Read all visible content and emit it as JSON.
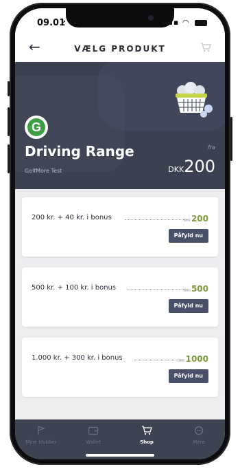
{
  "status": {
    "time": "09.01",
    "signal": "▪▪▪",
    "wifi": "◠"
  },
  "nav": {
    "title": "VÆLG PRODUKT"
  },
  "hero": {
    "club_initial": "G",
    "title": "Driving Range",
    "subtitle": "GolfMore Test",
    "from_label": "fra",
    "currency": "DKK",
    "price": "200"
  },
  "products": [
    {
      "label": "200 kr. + 40 kr. i bonus",
      "currency": "DKK",
      "price": "200",
      "button": "Påfyld nu"
    },
    {
      "label": "500 kr. + 100 kr. i bonus",
      "currency": "DKK",
      "price": "500",
      "button": "Påfyld nu"
    },
    {
      "label": "1.000 kr. + 300 kr. i bonus",
      "currency": "DKK",
      "price": "1000",
      "button": "Påfyld nu"
    }
  ],
  "tabs": [
    {
      "label": "Mine klubber",
      "icon": "flag-icon",
      "active": false
    },
    {
      "label": "Wallet",
      "icon": "wallet-icon",
      "active": false
    },
    {
      "label": "Shop",
      "icon": "cart-icon",
      "active": true
    },
    {
      "label": "Mere",
      "icon": "more-icon",
      "active": false
    }
  ],
  "colors": {
    "accent_green": "#7e9a3e",
    "button": "#48506a",
    "hero_bg": "#3b4150",
    "tabbar_bg": "#3e4352"
  }
}
